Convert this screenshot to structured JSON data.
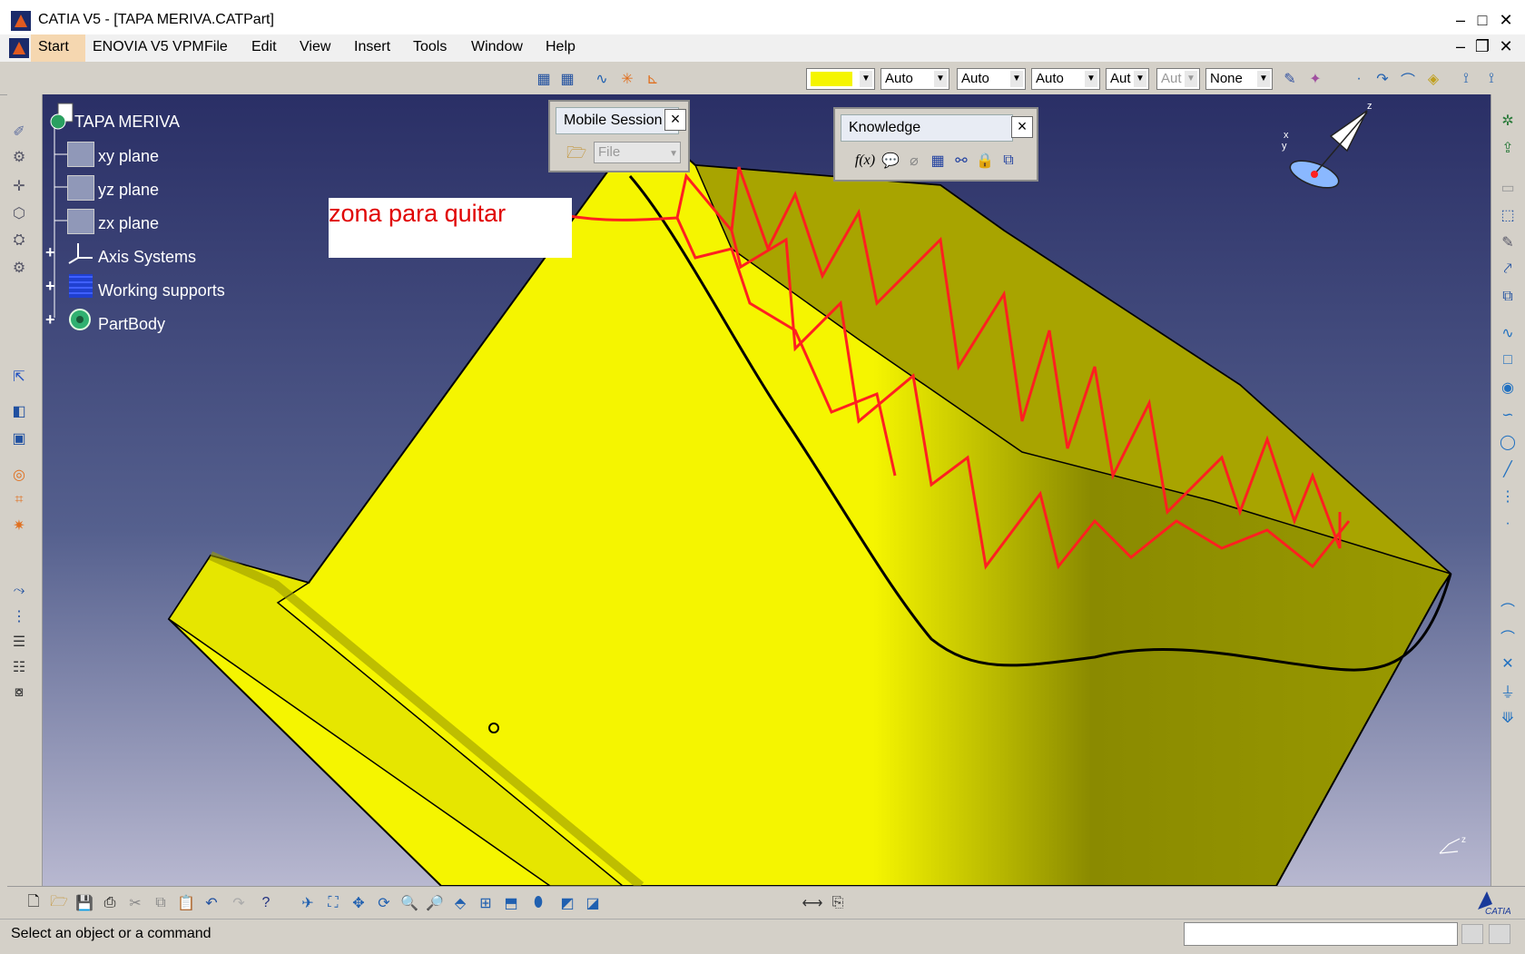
{
  "window": {
    "title": "CATIA V5 - [TAPA MERIVA.CATPart]",
    "controls": [
      "minimize",
      "maximize",
      "close"
    ],
    "doc_controls": [
      "minimize",
      "restore",
      "close"
    ]
  },
  "menu": [
    "Start",
    "ENOVIA V5 VPM",
    "File",
    "Edit",
    "View",
    "Insert",
    "Tools",
    "Window",
    "Help"
  ],
  "graphic_properties": {
    "fill_color": "#f5f500",
    "transparency": "Auto",
    "line_thickness": "Auto",
    "line_type": "Auto",
    "point_symbol": "Aut",
    "rendering": "Aut",
    "layer": "None"
  },
  "tree": {
    "root": "TAPA MERIVA",
    "items": [
      {
        "label": "xy plane",
        "icon": "plane-icon"
      },
      {
        "label": "yz plane",
        "icon": "plane-icon"
      },
      {
        "label": "zx plane",
        "icon": "plane-icon"
      },
      {
        "label": "Axis Systems",
        "icon": "axis-icon"
      },
      {
        "label": "Working supports",
        "icon": "grid-icon"
      },
      {
        "label": "PartBody",
        "icon": "partbody-icon"
      }
    ]
  },
  "mobile_session": {
    "title": "Mobile Session",
    "file_placeholder": "File"
  },
  "knowledge": {
    "title": "Knowledge",
    "tools": [
      "formula-icon",
      "comment-icon",
      "tolerance-icon",
      "design-table-icon",
      "law-icon",
      "check-icon",
      "rule-icon"
    ]
  },
  "annotation": {
    "text": "zona para quitar",
    "color": "#e00000"
  },
  "viewport": {
    "bg_top": "#2a2f66",
    "bg_bottom": "#b8b8d0",
    "part_color": "#f5f500"
  },
  "status": {
    "text": "Select an object or a command"
  },
  "brand": "CATIA"
}
